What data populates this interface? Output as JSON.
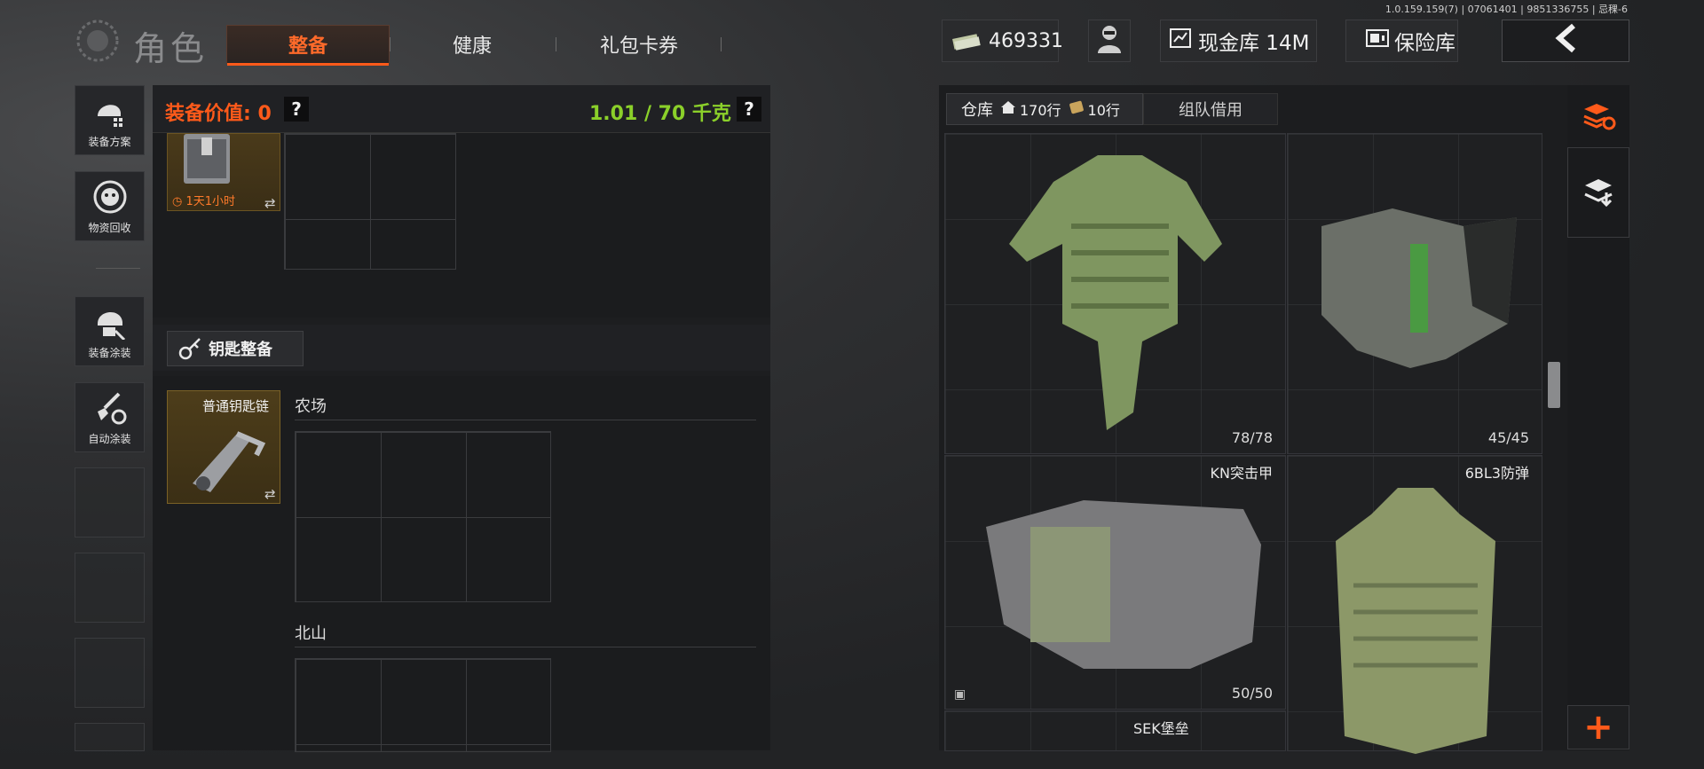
{
  "build_info": "1.0.159.159(7) | 07061401 | 9851336755 | 忌稞-6",
  "header": {
    "title": "角色",
    "tabs": [
      {
        "label": "整备",
        "active": true
      },
      {
        "label": "健康",
        "active": false
      },
      {
        "label": "礼包卡券",
        "active": false
      }
    ],
    "currency": "469331",
    "cash_vault_label": "现金库 14M",
    "safe_label": "保险库"
  },
  "sidebar": {
    "items": [
      {
        "label": "装备方案",
        "icon": "helmet-grid-icon"
      },
      {
        "label": "物资回收",
        "icon": "recycle-face-icon"
      },
      {
        "label": "装备涂装",
        "icon": "helmet-paint-icon"
      },
      {
        "label": "自动涂装",
        "icon": "brush-gear-icon"
      }
    ]
  },
  "loadout": {
    "equip_value_label": "装备价值: 0",
    "weight_label": "1.01 / 70 千克",
    "help_glyph": "?",
    "case_timer": "1天1小时",
    "swap_glyph": "⇄",
    "key_section_label": "钥匙整备",
    "key_item_name": "普通钥匙链",
    "locations": [
      "农场",
      "北山"
    ]
  },
  "warehouse": {
    "tab_label": "仓库",
    "rows_label": "170行",
    "extra_rows_label": "10行",
    "team_tab_label": "组队借用",
    "items": [
      {
        "name": "",
        "durability": "78/78"
      },
      {
        "name": "",
        "durability": "45/45"
      },
      {
        "name": "KN突击甲",
        "durability": "50/50"
      },
      {
        "name": "6BL3防弹",
        "durability": ""
      },
      {
        "name": "SEK堡垒",
        "durability": ""
      }
    ]
  },
  "colors": {
    "accent_orange": "#ff5a1a",
    "weight_green": "#8bd02a"
  }
}
